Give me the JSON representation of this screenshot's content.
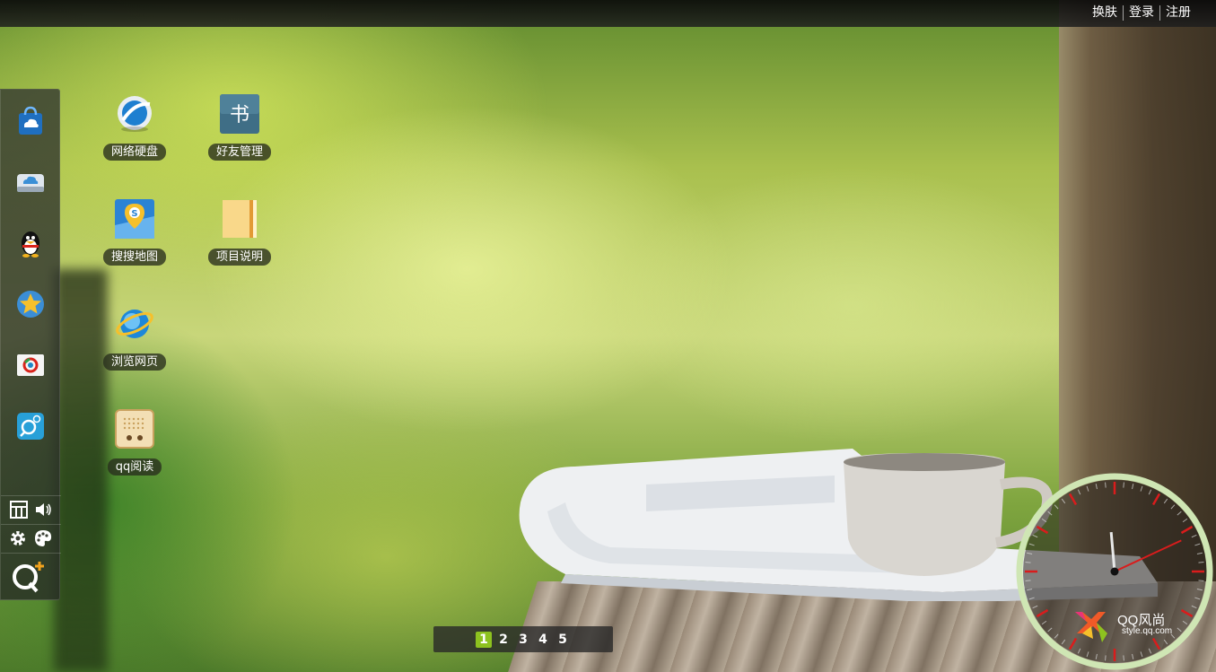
{
  "topbar": {
    "links": [
      "换肤",
      "登录",
      "注册"
    ]
  },
  "dock": {
    "apps": [
      {
        "name": "app-store-icon",
        "color": "#2a7fcf"
      },
      {
        "name": "cloud-drive-icon",
        "color": "#3a8fd6"
      },
      {
        "name": "qq-penguin-icon",
        "color": "#111111"
      },
      {
        "name": "qq-star-icon",
        "color": "#f2b21e"
      },
      {
        "name": "qq-photo-icon",
        "color": "#ffffff"
      },
      {
        "name": "search-app-icon",
        "color": "#28a0d8"
      }
    ],
    "tools": [
      "grid-view-icon",
      "volume-icon",
      "settings-gear-icon",
      "palette-icon",
      "q-plus-icon"
    ]
  },
  "desktop": {
    "icons": [
      {
        "label": "网络硬盘",
        "icon": "network-disk-icon"
      },
      {
        "label": "好友管理",
        "icon": "book-icon"
      },
      {
        "label": "搜搜地图",
        "icon": "map-icon"
      },
      {
        "label": "项目说明",
        "icon": "folder-icon"
      },
      {
        "label": "浏览网页",
        "icon": "ie-browser-icon"
      },
      {
        "label": "qq阅读",
        "icon": "reader-icon"
      }
    ]
  },
  "pager": {
    "pages": [
      "1",
      "2",
      "3",
      "4",
      "5"
    ],
    "active": "1"
  },
  "clock": {
    "hour_angle_deg": -5,
    "minute_angle_deg": 65,
    "accent_color": "#d91c1c",
    "ring_color": "#cfe6b4"
  },
  "watermark": {
    "brand": "QQ风尚",
    "site": "style.qq.com"
  }
}
